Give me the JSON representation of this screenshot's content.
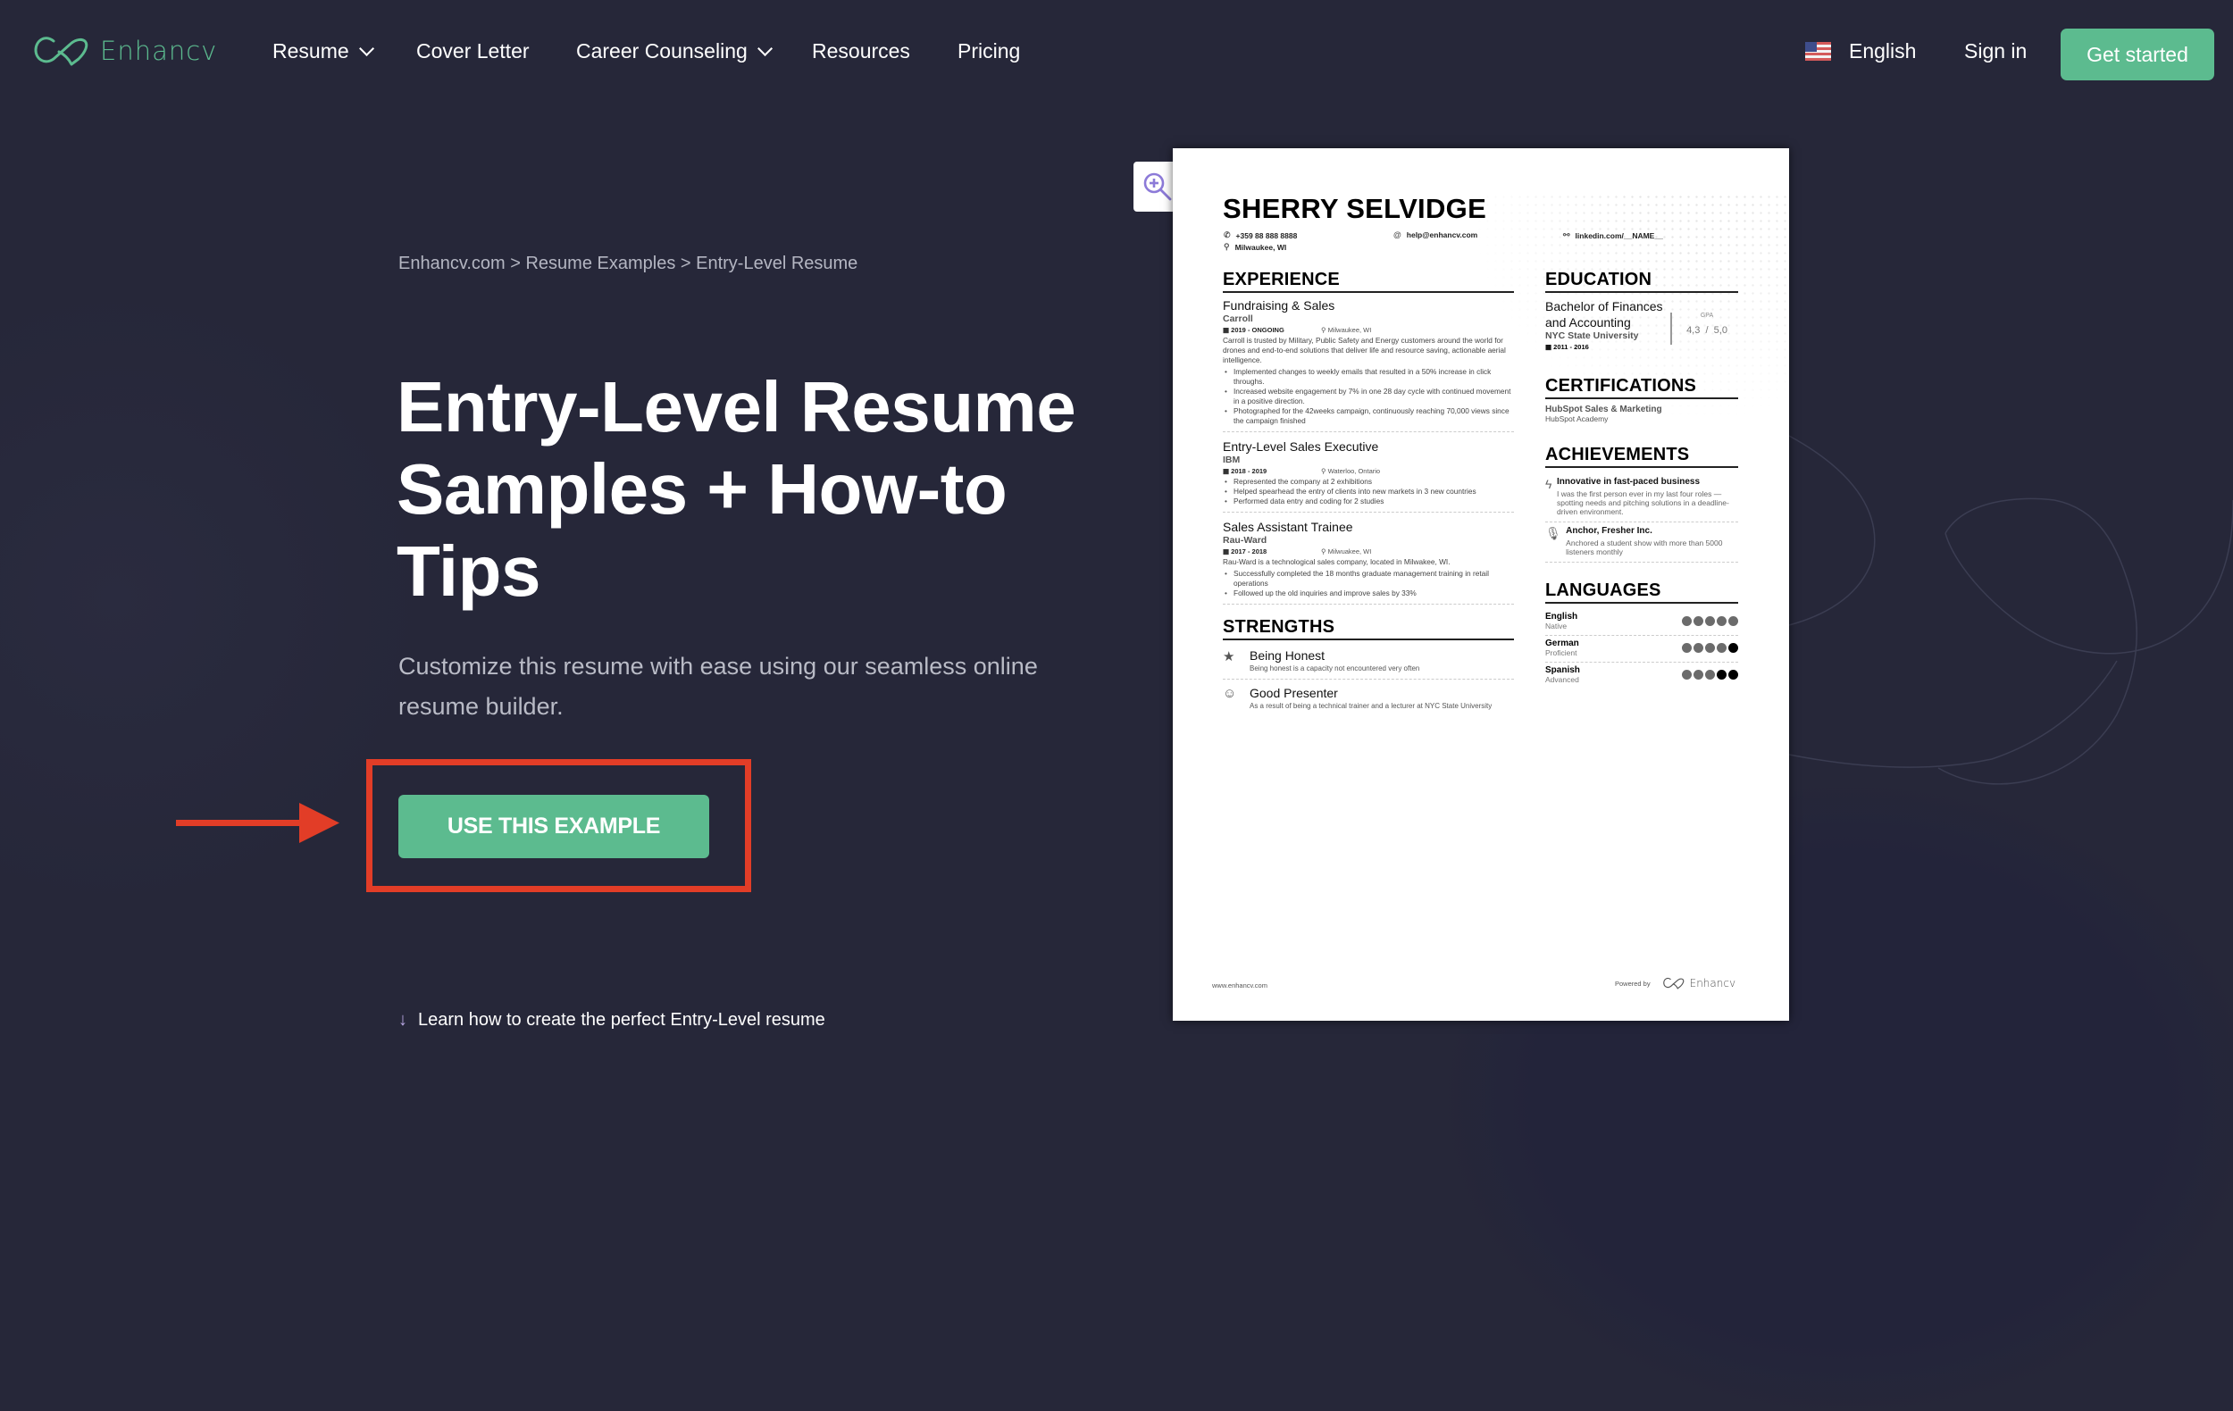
{
  "nav": {
    "brand": "Enhancv",
    "items": [
      {
        "label": "Resume",
        "has_dropdown": true
      },
      {
        "label": "Cover Letter",
        "has_dropdown": false
      },
      {
        "label": "Career Counseling",
        "has_dropdown": true
      },
      {
        "label": "Resources",
        "has_dropdown": false
      },
      {
        "label": "Pricing",
        "has_dropdown": false
      }
    ],
    "language": {
      "label": "English",
      "flag": "us-flag-icon"
    },
    "sign_in": "Sign in",
    "get_started": "Get started"
  },
  "hero": {
    "breadcrumb": "Enhancv.com > Resume Examples > Entry-Level Resume",
    "title_lines": [
      "Entry-Level Resume",
      "Samples + How-to",
      "Tips"
    ],
    "subtitle": "Customize this resume with ease using our seamless online resume builder.",
    "cta": "USE THIS EXAMPLE",
    "learn_link": "Learn how to create the perfect Entry-Level resume",
    "learn_icon": "arrow-down-icon"
  },
  "annotation": {
    "box_color": "#e23d27",
    "arrow_color": "#e23d27"
  },
  "colors": {
    "brand_green": "#5cbb8f",
    "background": "#262739",
    "zoom_icon": "#8c7ad8"
  },
  "resume": {
    "zoom_icon": "zoom-in-icon",
    "name": "SHERRY SELVIDGE",
    "phone": "+359 88 888 8888",
    "email": "help@enhancv.com",
    "linkedin": "linkedin.com/__NAME__",
    "location": "Milwaukee, WI",
    "experience_heading": "EXPERIENCE",
    "jobs": [
      {
        "title": "Fundraising & Sales",
        "company": "Carroll",
        "dates": "2019 - ONGOING",
        "location": "Milwaukee, WI",
        "description": "Carroll is trusted by Military, Public Safety and Energy customers around the world for drones and end-to-end solutions that deliver life and resource saving, actionable aerial intelligence.",
        "bullets": [
          "Implemented changes to weekly emails that resulted in a 50% increase in click throughs.",
          "Increased website engagement by 7% in one 28 day cycle with continued movement in a positive direction.",
          "Photographed for the 42weeks campaign, continuously reaching 70,000 views since the campaign finished"
        ]
      },
      {
        "title": "Entry-Level Sales Executive",
        "company": "IBM",
        "dates": "2018 - 2019",
        "location": "Waterloo, Ontario",
        "description": "",
        "bullets": [
          "Represented the company at 2 exhibitions",
          "Helped spearhead the entry of clients into new markets in 3 new countries",
          "Performed data entry and coding for 2 studies"
        ]
      },
      {
        "title": "Sales Assistant Trainee",
        "company": "Rau-Ward",
        "dates": "2017 - 2018",
        "location": "Milwuakee, WI",
        "description": "Rau-Ward is a technological sales company, located in Milwakee, WI.",
        "bullets": [
          "Successfully completed the 18 months graduate management training in retail operations",
          "Followed up the old inquiries and improve sales by 33%"
        ]
      }
    ],
    "strengths_heading": "STRENGTHS",
    "strengths": [
      {
        "icon": "star-icon",
        "title": "Being Honest",
        "desc": "Being honest is a capacity not encountered very often"
      },
      {
        "icon": "presenter-icon",
        "title": "Good Presenter",
        "desc": "As a result of being a technical trainer and a lecturer at NYC State University"
      }
    ],
    "education_heading": "EDUCATION",
    "education": {
      "degree": "Bachelor of Finances and Accounting",
      "school": "NYC State University",
      "dates": "2011 - 2016",
      "gpa_label": "GPA",
      "gpa_value": "4,3",
      "gpa_max": "5,0"
    },
    "certifications_heading": "CERTIFICATIONS",
    "certifications": [
      {
        "title": "HubSpot Sales & Marketing",
        "issuer": "HubSpot Academy"
      }
    ],
    "achievements_heading": "ACHIEVEMENTS",
    "achievements": [
      {
        "icon": "lightning-icon",
        "title": "Innovative in fast-paced business",
        "desc": "I was the first person ever in my last four roles — spotting needs and pitching solutions in a deadline-driven environment."
      },
      {
        "icon": "microphone-icon",
        "title": "Anchor, Fresher Inc.",
        "desc": "Anchored a student show with more than 5000 listeners monthly"
      }
    ],
    "languages_heading": "LANGUAGES",
    "languages": [
      {
        "name": "English",
        "level": "Native",
        "rating": 5,
        "dark_dots": 0
      },
      {
        "name": "German",
        "level": "Proficient",
        "rating": 5,
        "dark_dots": 1
      },
      {
        "name": "Spanish",
        "level": "Advanced",
        "rating": 5,
        "dark_dots": 2
      }
    ],
    "footer_site": "www.enhancv.com",
    "footer_powered": "Powered by",
    "footer_brand": "Enhancv"
  }
}
